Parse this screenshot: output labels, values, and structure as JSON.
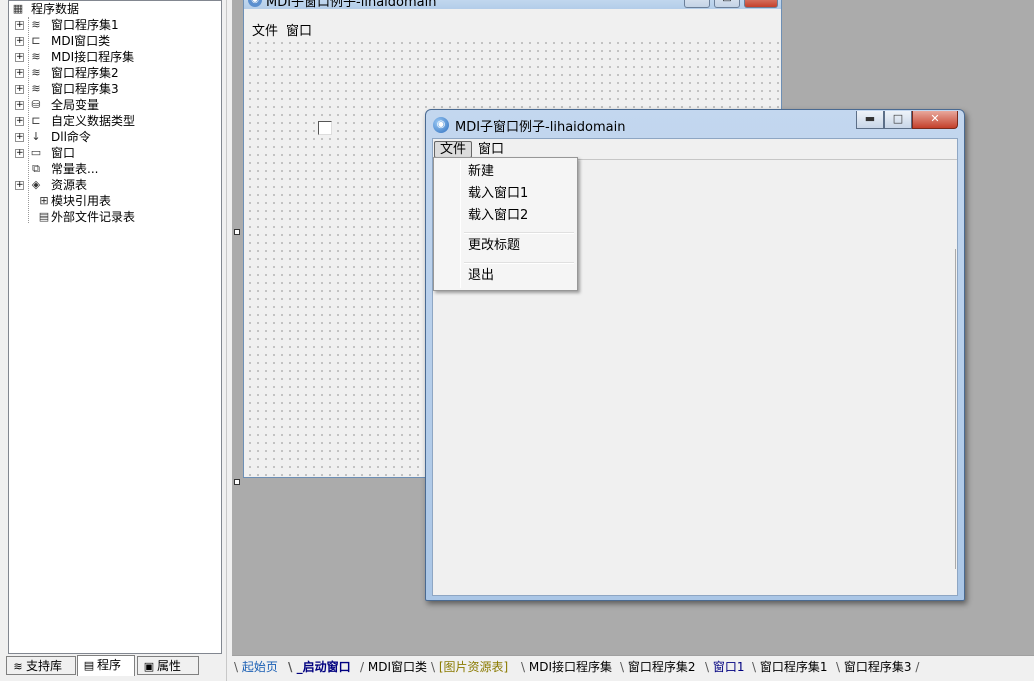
{
  "tree": {
    "root_label": "程序数据",
    "items": [
      {
        "label": "窗口程序集1",
        "icon": "assembly-icon",
        "expandable": true
      },
      {
        "label": "MDI窗口类",
        "icon": "class-icon",
        "expandable": true
      },
      {
        "label": "MDI接口程序集",
        "icon": "assembly-icon",
        "expandable": true
      },
      {
        "label": "窗口程序集2",
        "icon": "assembly-icon",
        "expandable": true
      },
      {
        "label": "窗口程序集3",
        "icon": "assembly-icon",
        "expandable": true
      },
      {
        "label": "全局变量",
        "icon": "global-var-icon",
        "expandable": true
      },
      {
        "label": "自定义数据类型",
        "icon": "class-icon",
        "expandable": true
      },
      {
        "label": "Dll命令",
        "icon": "dll-icon",
        "expandable": true
      },
      {
        "label": "窗口",
        "icon": "window-icon",
        "expandable": true
      },
      {
        "label": "常量表...",
        "icon": "constant-icon",
        "expandable": false
      },
      {
        "label": "资源表",
        "icon": "resource-icon",
        "expandable": true
      },
      {
        "label": "模块引用表",
        "icon": "module-icon",
        "expandable": false
      },
      {
        "label": "外部文件记录表",
        "icon": "file-icon",
        "expandable": false
      }
    ]
  },
  "left_tabs": [
    {
      "label": "支持库",
      "icon": "library-icon",
      "active": false
    },
    {
      "label": "程序",
      "icon": "program-icon",
      "active": true
    },
    {
      "label": "属性",
      "icon": "property-icon",
      "active": false
    }
  ],
  "design_form": {
    "title": "MDI子窗口例子-lihaidomain",
    "menu": [
      "文件",
      "窗口"
    ]
  },
  "mdi_window": {
    "title": "MDI子窗口例子-lihaidomain",
    "menu": [
      "文件",
      "窗口"
    ],
    "minimize": "▬",
    "maximize": "□",
    "close": "✕"
  },
  "dropdown": {
    "items": [
      "新建",
      "载入窗口1",
      "载入窗口2",
      "更改标题",
      "退出"
    ]
  },
  "bottom_tabs": [
    {
      "label": "起始页",
      "color": "#1a5fb4",
      "active": false
    },
    {
      "label": "_启动窗口",
      "color": "#000080",
      "active": true
    },
    {
      "label": "MDI窗口类",
      "color": "#000000",
      "active": false
    },
    {
      "label": "[图片资源表]",
      "color": "#8a7a00",
      "active": false
    },
    {
      "label": "MDI接口程序集",
      "color": "#000000",
      "active": false
    },
    {
      "label": "窗口程序集2",
      "color": "#000000",
      "active": false
    },
    {
      "label": "窗口1",
      "color": "#000080",
      "active": false
    },
    {
      "label": "窗口程序集1",
      "color": "#000000",
      "active": false
    },
    {
      "label": "窗口程序集3",
      "color": "#000000",
      "active": false
    }
  ]
}
